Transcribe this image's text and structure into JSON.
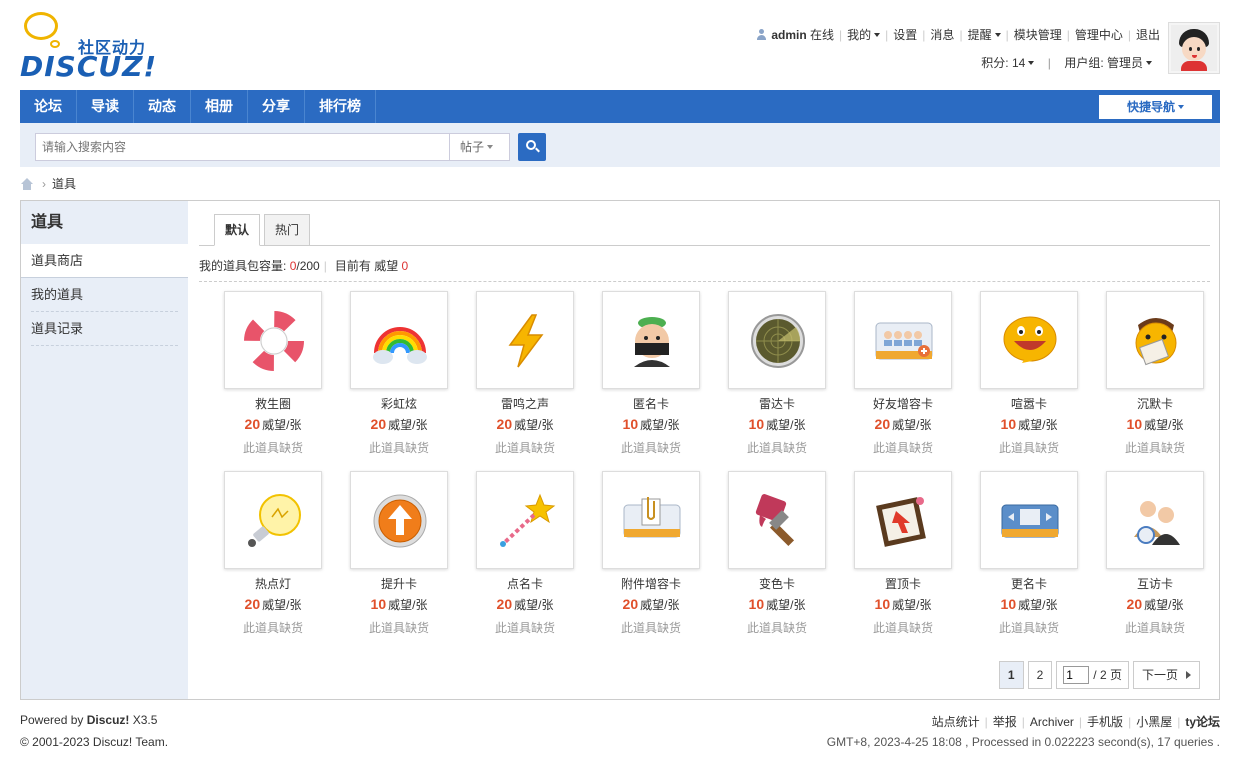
{
  "logo": {
    "cn": "社区动力",
    "en": "DISCUZ!"
  },
  "userbar": {
    "username": "admin",
    "status": "在线",
    "links": [
      "我的",
      "设置",
      "消息",
      "提醒",
      "模块管理",
      "管理中心",
      "退出"
    ],
    "credits_label": "积分: 14",
    "group_label": "用户组: 管理员"
  },
  "nav": {
    "items": [
      "论坛",
      "导读",
      "动态",
      "相册",
      "分享",
      "排行榜"
    ],
    "quick_nav": "快捷导航"
  },
  "search": {
    "placeholder": "请输入搜索内容",
    "type": "帖子"
  },
  "breadcrumb": {
    "current": "道具"
  },
  "sidebar": {
    "title": "道具",
    "items": [
      "道具商店",
      "我的道具",
      "道具记录"
    ]
  },
  "tabs": [
    "默认",
    "热门"
  ],
  "bag": {
    "label": "我的道具包容量:",
    "used": "0",
    "total": "/200",
    "prestige_label": "目前有 威望",
    "prestige_value": "0"
  },
  "items": [
    {
      "name": "救生圈",
      "price": "20",
      "unit": "威望/张",
      "stock": "此道具缺货",
      "icon": "lifebuoy-icon"
    },
    {
      "name": "彩虹炫",
      "price": "20",
      "unit": "威望/张",
      "stock": "此道具缺货",
      "icon": "rainbow-icon"
    },
    {
      "name": "雷鸣之声",
      "price": "20",
      "unit": "威望/张",
      "stock": "此道具缺货",
      "icon": "lightning-icon"
    },
    {
      "name": "匿名卡",
      "price": "10",
      "unit": "威望/张",
      "stock": "此道具缺货",
      "icon": "anonymous-icon"
    },
    {
      "name": "雷达卡",
      "price": "10",
      "unit": "威望/张",
      "stock": "此道具缺货",
      "icon": "radar-icon"
    },
    {
      "name": "好友增容卡",
      "price": "20",
      "unit": "威望/张",
      "stock": "此道具缺货",
      "icon": "friends-card-icon"
    },
    {
      "name": "喧嚣卡",
      "price": "10",
      "unit": "威望/张",
      "stock": "此道具缺货",
      "icon": "loud-face-icon"
    },
    {
      "name": "沉默卡",
      "price": "10",
      "unit": "威望/张",
      "stock": "此道具缺货",
      "icon": "silent-face-icon"
    },
    {
      "name": "热点灯",
      "price": "20",
      "unit": "威望/张",
      "stock": "此道具缺货",
      "icon": "bulb-icon"
    },
    {
      "name": "提升卡",
      "price": "10",
      "unit": "威望/张",
      "stock": "此道具缺货",
      "icon": "up-arrow-icon"
    },
    {
      "name": "点名卡",
      "price": "20",
      "unit": "威望/张",
      "stock": "此道具缺货",
      "icon": "magic-wand-icon"
    },
    {
      "name": "附件增容卡",
      "price": "20",
      "unit": "威望/张",
      "stock": "此道具缺货",
      "icon": "attachment-card-icon"
    },
    {
      "name": "变色卡",
      "price": "10",
      "unit": "威望/张",
      "stock": "此道具缺货",
      "icon": "paint-brush-icon"
    },
    {
      "name": "置顶卡",
      "price": "10",
      "unit": "威望/张",
      "stock": "此道具缺货",
      "icon": "pin-top-icon"
    },
    {
      "name": "更名卡",
      "price": "10",
      "unit": "威望/张",
      "stock": "此道具缺货",
      "icon": "id-card-icon"
    },
    {
      "name": "互访卡",
      "price": "20",
      "unit": "威望/张",
      "stock": "此道具缺货",
      "icon": "mutual-visit-icon"
    }
  ],
  "pager": {
    "pages": [
      "1",
      "2"
    ],
    "current_input": "1",
    "total": "/ 2 页",
    "next": "下一页"
  },
  "footer": {
    "powered_prefix": "Powered by",
    "powered_brand": "Discuz!",
    "version": "X3.5",
    "copyright": "© 2001-2023 Discuz! Team.",
    "links": [
      "站点统计",
      "举报",
      "Archiver",
      "手机版",
      "小黑屋"
    ],
    "site": "ty论坛",
    "stats": "GMT+8, 2023-4-25 18:08 , Processed in 0.022223 second(s), 17 queries ."
  }
}
